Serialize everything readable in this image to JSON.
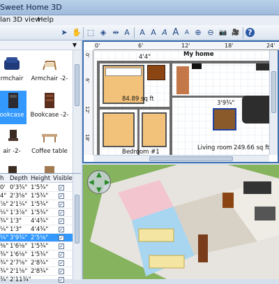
{
  "window": {
    "title": "Sweet Home 3D"
  },
  "menu": {
    "items": [
      "lan",
      "3D view",
      "Help"
    ]
  },
  "toolbar": {
    "icons": [
      "select-arrow-icon",
      "pan-hand-icon",
      "create-walls-icon",
      "create-rooms-icon",
      "create-dimensions-icon",
      "add-text-icon",
      "text-style-icon",
      "bold-icon",
      "italic-icon",
      "increase-text-icon",
      "decrease-text-icon",
      "zoom-in-icon",
      "zoom-out-icon",
      "create-photo-icon",
      "create-video-icon",
      "help-icon"
    ],
    "glyphs": [
      "➤",
      "✋",
      "⬚",
      "◈",
      "⇹",
      "A",
      "A",
      "A",
      "A",
      "A",
      "A",
      "⊕",
      "⊖",
      "📷",
      "🎥",
      "?"
    ]
  },
  "catalog": {
    "items": [
      {
        "label": "rmchair",
        "selected": false
      },
      {
        "label": "Armchair -2-",
        "selected": false
      },
      {
        "label": "ookcase",
        "selected": true
      },
      {
        "label": "Bookcase -2-",
        "selected": false
      },
      {
        "label": "air -2-",
        "selected": false
      },
      {
        "label": "Coffee table",
        "selected": false
      }
    ]
  },
  "furniture_table": {
    "headers": [
      "h",
      "Depth",
      "Height",
      "Visible"
    ],
    "rows": [
      {
        "w": "0'",
        "depth": "0'3¾\"",
        "height": "1'5¾\"",
        "selected": false
      },
      {
        "w": "4\"",
        "depth": "2'3⅝\"",
        "height": "1'5¾\"",
        "selected": false
      },
      {
        "w": "⅞\"",
        "depth": "2'1¼\"",
        "height": "1'5¾\"",
        "selected": false
      },
      {
        "w": "¼\"",
        "depth": "1'3⅞\"",
        "height": "1'5¾\"",
        "selected": false
      },
      {
        "w": "¾\"",
        "depth": "1'3\"",
        "height": "4'4¾\"",
        "selected": false
      },
      {
        "w": "¼\"",
        "depth": "1'3\"",
        "height": "4'4¾\"",
        "selected": false
      },
      {
        "w": "¼\"",
        "depth": "3'9¾\"",
        "height": "2'5⅛\"",
        "selected": true
      },
      {
        "w": "⅜\"",
        "depth": "1'6⅛\"",
        "height": "1'5¾\"",
        "selected": false
      },
      {
        "w": "¾\"",
        "depth": "1'6⅛\"",
        "height": "1'5¾\"",
        "selected": false
      },
      {
        "w": "¾\"",
        "depth": "2'7⅝\"",
        "height": "2'8¾\"",
        "selected": false
      },
      {
        "w": "¾\"",
        "depth": "2'1⅝\"",
        "height": "2'8¾\"",
        "selected": false
      },
      {
        "w": "¾\"",
        "depth": "2'11¾\"",
        "height": "",
        "selected": false
      }
    ]
  },
  "plan": {
    "title": "My home",
    "ruler_ticks": [
      "0'",
      "6'",
      "12'",
      "18'",
      "24'"
    ],
    "ruler_vticks": [
      "0'",
      "6'",
      "12'",
      "18'"
    ],
    "rooms": [
      {
        "name": "",
        "area": "84.89 sq ft"
      },
      {
        "name": "Bedroom #1",
        "area": ""
      },
      {
        "name": "Living room",
        "area": "249.66 sq ft"
      }
    ],
    "dimensions": [
      "4'4\"",
      "3'9¾\""
    ]
  },
  "colors": {
    "accent": "#3399ff",
    "plan_border": "#3a6fb0",
    "grass": "#86b35e"
  }
}
